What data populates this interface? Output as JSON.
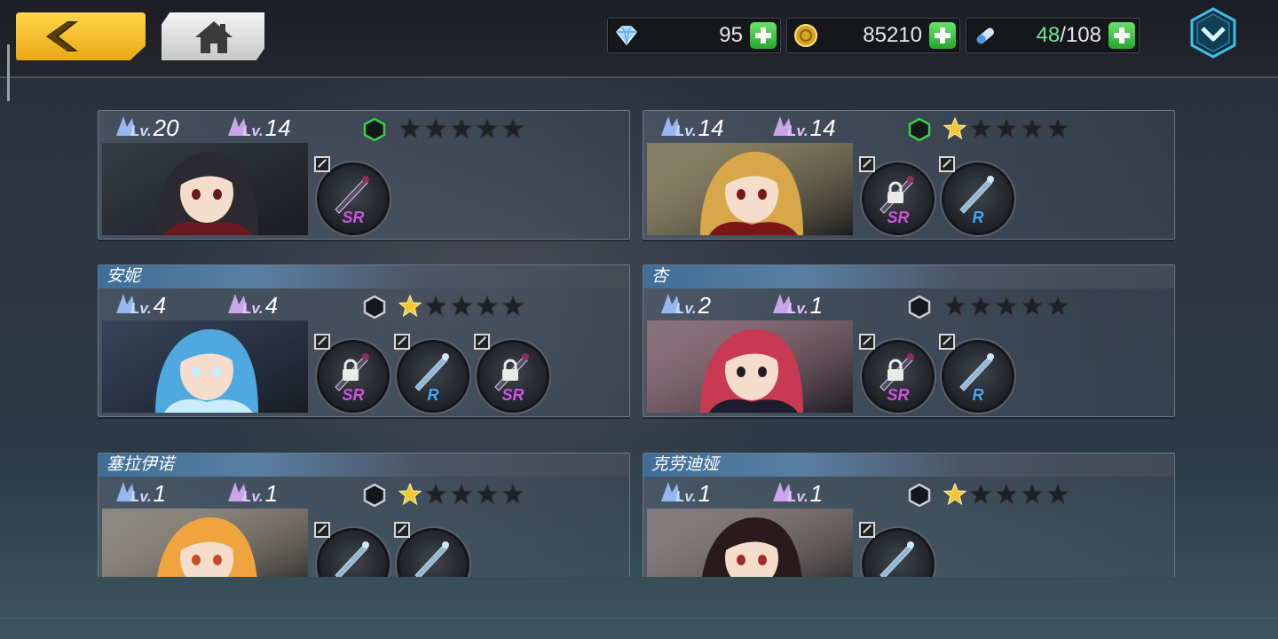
{
  "topbar": {
    "back_icon": "back-arrow-icon",
    "home_icon": "home-icon",
    "crystal": {
      "icon": "crystal-icon",
      "value": "95"
    },
    "gold": {
      "icon": "gold-coin-icon",
      "value": "85210"
    },
    "stamina": {
      "icon": "stamina-icon",
      "current": "48",
      "max": "/108"
    },
    "menu_icon": "chevron-down-menu-icon"
  },
  "colors": {
    "accent_gold": "#f0b51f",
    "stamina_green": "#6fe39a",
    "star_gold": "#f4c534"
  },
  "characters": [
    {
      "name": "",
      "lv1_tag": "Lv.",
      "lv1": "20",
      "lv2_tag": "Lv.",
      "lv2": "14",
      "stars": 0,
      "hex": "green",
      "equips": [
        {
          "rarity": "SR",
          "locked": false
        }
      ]
    },
    {
      "name": "",
      "lv1_tag": "Lv.",
      "lv1": "14",
      "lv2_tag": "Lv.",
      "lv2": "14",
      "stars": 1,
      "hex": "green",
      "equips": [
        {
          "rarity": "SR",
          "locked": true
        },
        {
          "rarity": "R",
          "locked": false
        }
      ]
    },
    {
      "name": "安妮",
      "lv1_tag": "Lv.",
      "lv1": "4",
      "lv2_tag": "Lv.",
      "lv2": "4",
      "stars": 1,
      "hex": "grey",
      "equips": [
        {
          "rarity": "SR",
          "locked": true
        },
        {
          "rarity": "R",
          "locked": false
        },
        {
          "rarity": "SR",
          "locked": true
        }
      ]
    },
    {
      "name": "杏",
      "lv1_tag": "Lv.",
      "lv1": "2",
      "lv2_tag": "Lv.",
      "lv2": "1",
      "stars": 0,
      "hex": "grey",
      "equips": [
        {
          "rarity": "SR",
          "locked": true
        },
        {
          "rarity": "R",
          "locked": false
        }
      ]
    },
    {
      "name": "塞拉伊诺",
      "lv1_tag": "Lv.",
      "lv1": "1",
      "lv2_tag": "Lv.",
      "lv2": "1",
      "stars": 1,
      "hex": "grey",
      "equips": [
        {
          "rarity": "R",
          "locked": false
        },
        {
          "rarity": "R",
          "locked": false
        }
      ]
    },
    {
      "name": "克劳迪娅",
      "lv1_tag": "Lv.",
      "lv1": "1",
      "lv2_tag": "Lv.",
      "lv2": "1",
      "stars": 1,
      "hex": "grey",
      "equips": [
        {
          "rarity": "R",
          "locked": false
        }
      ]
    }
  ]
}
